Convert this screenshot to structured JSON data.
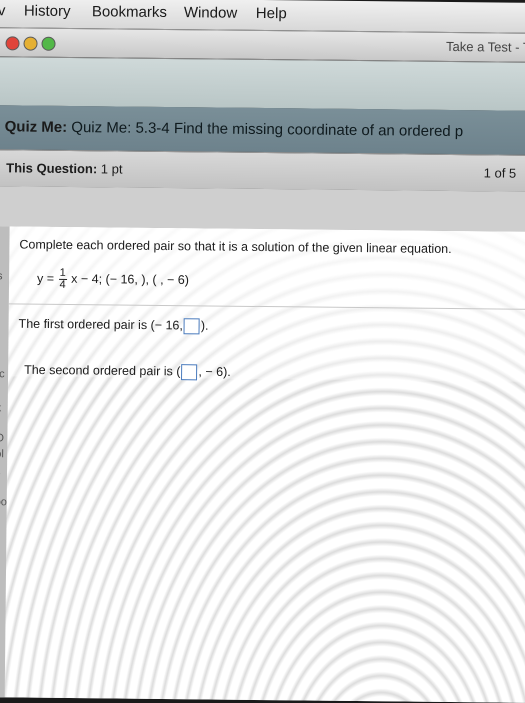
{
  "menubar": {
    "items": [
      "v",
      "History",
      "Bookmarks",
      "Window",
      "Help"
    ]
  },
  "window": {
    "title": "Take a Test - Tal"
  },
  "quiz": {
    "label": "Quiz Me:",
    "title": "Quiz Me: 5.3-4 Find the missing coordinate of an ordered p"
  },
  "question_bar": {
    "label": "This Question:",
    "points": "1 pt",
    "progress": "1 of 5"
  },
  "question": {
    "instruction": "Complete each ordered pair so that it is a solution of the given linear equation.",
    "eq_prefix": "y =",
    "frac_num": "1",
    "frac_den": "4",
    "eq_rest": "x − 4; (− 16,  ), (  , − 6)",
    "first_prefix": "The first ordered pair is (− 16,",
    "first_suffix": ").",
    "second_prefix": "The second ordered pair is (",
    "second_suffix": ", − 6)."
  },
  "left_strip": [
    "s",
    "r",
    "tc",
    "k",
    "O",
    "ol",
    "s",
    "oo"
  ],
  "colors": {
    "quiz_header": "#7a8f98",
    "answer_box_border": "#4a7bbd"
  }
}
